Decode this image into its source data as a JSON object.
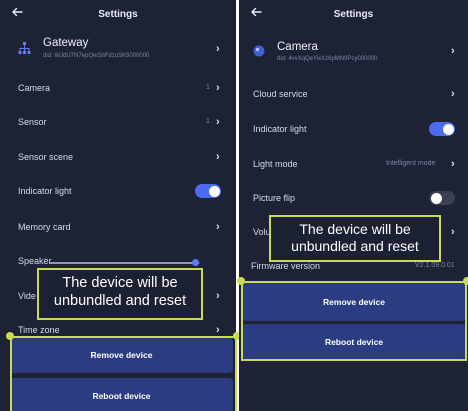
{
  "colors": {
    "background": "#1d2235",
    "button": "#2b3c80",
    "toggle_on": "#4a6bf2",
    "highlight": "#c8dc50"
  },
  "left": {
    "header": {
      "back_icon": "arrow-left-icon",
      "title": "Settings"
    },
    "device": {
      "icon": "sitemap-icon",
      "name": "Gateway",
      "did": "did: WJdU7N7epQwShFdzuSK5000000"
    },
    "camera_label": "Camera",
    "camera_value": "1",
    "sensor_label": "Sensor",
    "sensor_value": "1",
    "sensor_scene_label": "Sensor scene",
    "indicator_light_label": "Indicator light",
    "indicator_light_on": true,
    "memory_card_label": "Memory card",
    "speaker_label": "Speaker",
    "speaker_level": 0.97,
    "video_label": "Vide",
    "time_zone_label": "Time zone",
    "remove_device": "Remove device",
    "reboot_device": "Reboot device",
    "annotation": "The device will be unbundled and reset"
  },
  "right": {
    "header": {
      "back_icon": "arrow-left-icon",
      "title": "Settings"
    },
    "device": {
      "icon": "camera-dot-icon",
      "name": "Camera",
      "did": "did: 4vvXqQeYixXz6pMN9Pcy000000"
    },
    "cloud_service_label": "Cloud service",
    "indicator_light_label": "Indicator light",
    "indicator_light_on": true,
    "light_mode_label": "Light mode",
    "light_mode_value": "Intelligent mode",
    "picture_flip_label": "Picture flip",
    "picture_flip_on": false,
    "volume_label": "Volu",
    "firmware_label": "Firmware version",
    "firmware_value": "V2.1.09.0.01",
    "remove_device": "Remove device",
    "reboot_device": "Reboot device",
    "annotation": "The device will be unbundled and reset"
  }
}
